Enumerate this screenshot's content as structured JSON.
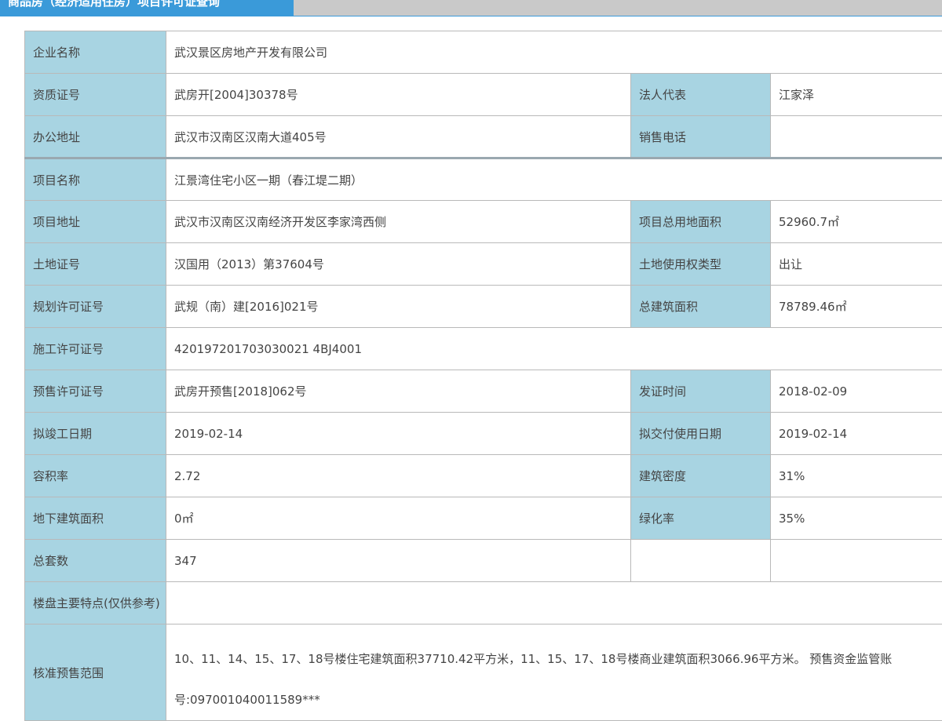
{
  "header": {
    "tab_label": "商品房（经济适用住房）项目许可证查询"
  },
  "colors": {
    "accent": "#3a9ad9",
    "label_bg": "#a8d4e2",
    "topbar_bg": "#c9c9c9"
  },
  "rows": {
    "r1": {
      "l1": "企业名称",
      "v1": "武汉景区房地产开发有限公司"
    },
    "r2": {
      "l1": "资质证号",
      "v1": "武房开[2004]30378号",
      "l2": "法人代表",
      "v2": "江家泽"
    },
    "r3": {
      "l1": "办公地址",
      "v1": "武汉市汉南区汉南大道405号",
      "l2": "销售电话",
      "v2": ""
    },
    "r4": {
      "l1": "项目名称",
      "v1": "江景湾住宅小区一期（春江堤二期）"
    },
    "r5": {
      "l1": "项目地址",
      "v1": "武汉市汉南区汉南经济开发区李家湾西侧",
      "l2": "项目总用地面积",
      "v2": "52960.7㎡"
    },
    "r6": {
      "l1": "土地证号",
      "v1": "汉国用（2013）第37604号",
      "l2": "土地使用权类型",
      "v2": "出让"
    },
    "r7": {
      "l1": "规划许可证号",
      "v1": "武规（南）建[2016]021号",
      "l2": "总建筑面积",
      "v2": "78789.46㎡"
    },
    "r8": {
      "l1": "施工许可证号",
      "v1": "420197201703030021 4BJ4001"
    },
    "r9": {
      "l1": "预售许可证号",
      "v1": "武房开预售[2018]062号",
      "l2": "发证时间",
      "v2": "2018-02-09"
    },
    "r10": {
      "l1": "拟竣工日期",
      "v1": "2019-02-14",
      "l2": "拟交付使用日期",
      "v2": "2019-02-14"
    },
    "r11": {
      "l1": "容积率",
      "v1": "2.72",
      "l2": "建筑密度",
      "v2": "31%"
    },
    "r12": {
      "l1": "地下建筑面积",
      "v1": "0㎡",
      "l2": "绿化率",
      "v2": "35%"
    },
    "r13": {
      "l1": "总套数",
      "v1": "347",
      "l2": "",
      "v2": ""
    },
    "r14": {
      "l1": "楼盘主要特点(仅供参考)",
      "v1": ""
    },
    "r15": {
      "l1": "核准预售范围",
      "v1": "10、11、14、15、17、18号楼住宅建筑面积37710.42平方米，11、15、17、18号楼商业建筑面积3066.96平方米。 预售资金监管账号:097001040011589***"
    }
  }
}
